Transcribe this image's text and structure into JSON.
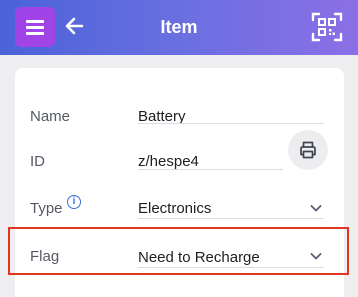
{
  "header": {
    "title": "Item",
    "accent_color": "#a044e8",
    "menu_icon": "hamburger-menu-icon",
    "back_icon": "arrow-left-icon",
    "scan_icon": "qr-scan-icon"
  },
  "form": {
    "name": {
      "label": "Name",
      "value": "Battery"
    },
    "id": {
      "label": "ID",
      "value": "z/hespe4",
      "print_icon": "printer-icon"
    },
    "type": {
      "label": "Type",
      "info_glyph": "i",
      "value": "Electronics"
    },
    "flag": {
      "label": "Flag",
      "value": "Need to Recharge",
      "highlight_color": "#e0361f"
    }
  }
}
